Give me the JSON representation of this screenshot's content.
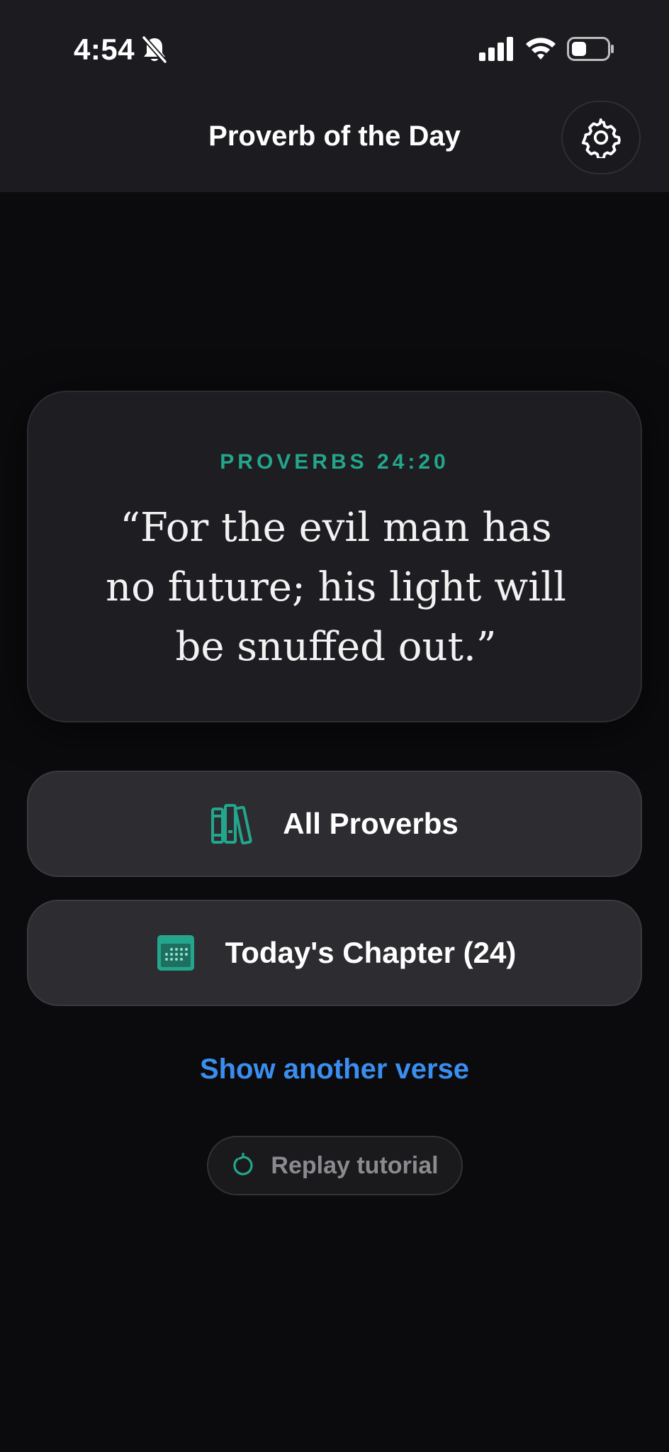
{
  "status_bar": {
    "time": "4:54"
  },
  "header": {
    "title": "Proverb of the Day",
    "settings_icon": "gear-icon"
  },
  "verse": {
    "reference": "PROVERBS 24:20",
    "text": "“For the evil man has no future; his light will be snuffed out.”"
  },
  "actions": {
    "all_proverbs": {
      "label": "All Proverbs",
      "icon": "books-icon"
    },
    "todays_chapter": {
      "label": "Today's Chapter (24)",
      "icon": "calendar-icon"
    }
  },
  "show_another": "Show another verse",
  "replay": {
    "label": "Replay tutorial",
    "icon": "replay-icon"
  },
  "colors": {
    "accent": "#23a68c",
    "link": "#3a8ef0",
    "header_bg": "#1c1c20",
    "page_bg": "#0b0b0d"
  }
}
